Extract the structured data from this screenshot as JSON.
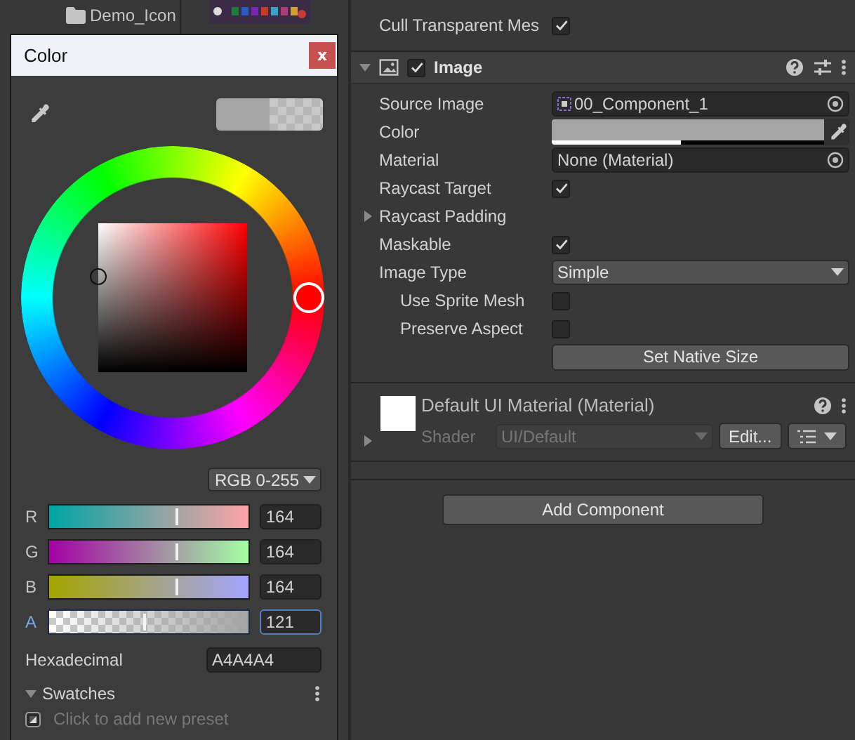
{
  "project": {
    "items": [
      {
        "label": "Demo_Icon"
      }
    ]
  },
  "color_window": {
    "title": "Color",
    "close": "x",
    "mode": "RGB 0-255",
    "channels": [
      {
        "label": "R",
        "level": 0.643,
        "value": "164",
        "selected": false
      },
      {
        "label": "G",
        "level": 0.643,
        "value": "164",
        "selected": false
      },
      {
        "label": "B",
        "level": 0.643,
        "value": "164",
        "selected": false
      },
      {
        "label": "A",
        "level": 0.475,
        "value": "121",
        "selected": true
      }
    ],
    "hexadecimal": {
      "label": "Hexadecimal",
      "value": "A4A4A4"
    },
    "swatches": {
      "label": "Swatches",
      "expanded": true,
      "hint": "Click to add new preset"
    }
  },
  "inspector": {
    "top_row": {
      "label": "Cull Transparent Mes",
      "checked": true
    },
    "component": {
      "title": "Image",
      "enabled": true,
      "expanded": true,
      "properties": [
        {
          "kind": "object",
          "label": "Source Image",
          "value": "00_Component_1",
          "indented": false
        },
        {
          "kind": "color",
          "label": "Color",
          "level": 0.475,
          "indented": false
        },
        {
          "kind": "object",
          "label": "Material",
          "value": "None (Material)",
          "indented": false
        },
        {
          "kind": "checkbox",
          "label": "Raycast Target",
          "checked": true,
          "indented": false
        },
        {
          "kind": "foldout",
          "label": "Raycast Padding",
          "expanded": false,
          "indented": false
        },
        {
          "kind": "checkbox",
          "label": "Maskable",
          "checked": true,
          "indented": false
        },
        {
          "kind": "dropdown",
          "label": "Image Type",
          "value": "Simple",
          "indented": false
        },
        {
          "kind": "checkbox",
          "label": "Use Sprite Mesh",
          "checked": false,
          "indented": true
        },
        {
          "kind": "checkbox",
          "label": "Preserve Aspect",
          "checked": false,
          "indented": true
        },
        {
          "kind": "button",
          "label": "Set Native Size",
          "indented": false
        }
      ]
    },
    "material": {
      "title": "Default UI Material (Material)",
      "shader_label": "Shader",
      "shader": "UI/Default",
      "edit": "Edit..."
    },
    "add_button": "Add Component"
  }
}
